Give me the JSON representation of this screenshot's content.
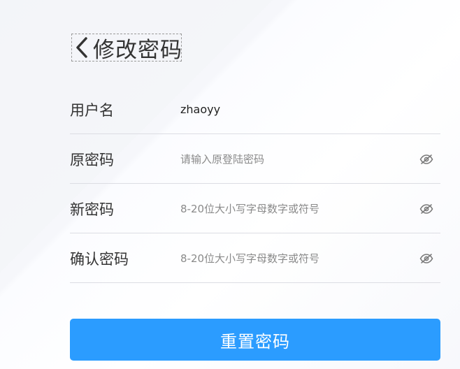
{
  "header": {
    "back_icon": "chevron-left-icon",
    "title": "修改密码"
  },
  "form": {
    "username": {
      "label": "用户名",
      "value": "zhaoyy"
    },
    "old_password": {
      "label": "原密码",
      "placeholder": "请输入原登陆密码",
      "toggle_icon": "eye-hidden-icon"
    },
    "new_password": {
      "label": "新密码",
      "placeholder": "8-20位大小写字母数字或符号",
      "toggle_icon": "eye-hidden-icon"
    },
    "confirm_password": {
      "label": "确认密码",
      "placeholder": "8-20位大小写字母数字或符号",
      "toggle_icon": "eye-hidden-icon"
    }
  },
  "submit": {
    "label": "重置密码"
  },
  "colors": {
    "accent": "#2b9cff",
    "text": "#333333",
    "placeholder": "#8a8a8a",
    "divider": "#dcdde3"
  }
}
